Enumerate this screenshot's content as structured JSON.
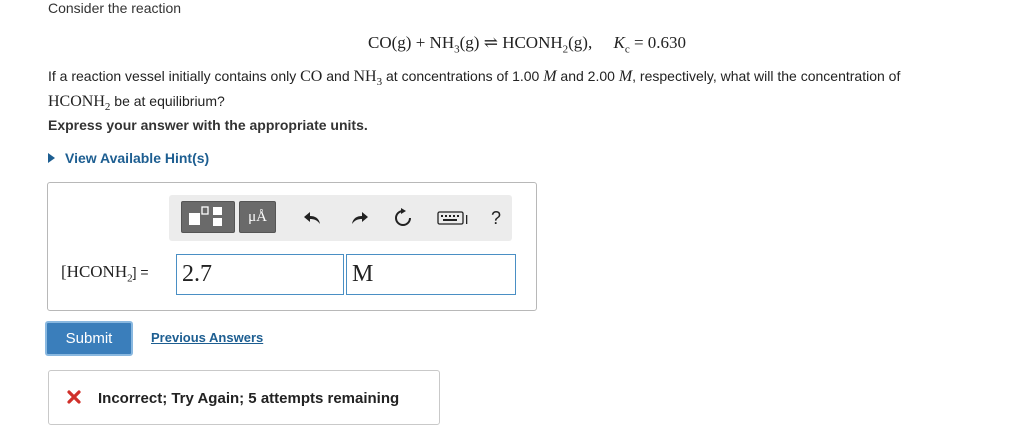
{
  "problem": {
    "intro": "Consider the reaction",
    "equation": {
      "reactant_1": "CO(g)",
      "plus": "+",
      "reactant_2_base": "NH",
      "reactant_2_sub": "3",
      "reactant_2_phase": "(g)",
      "arrow": "⇌",
      "product_base": "HCONH",
      "product_sub": "2",
      "product_phase": "(g),",
      "k_symbol": "K",
      "k_sub": "c",
      "k_value": "= 0.630"
    },
    "question": {
      "part_1": "If a reaction vessel initially contains only ",
      "species_1": "CO",
      "part_2": " and ",
      "species_2_base": "NH",
      "species_2_sub": "3",
      "part_3": " at concentrations of 1.00 ",
      "unit_1": "M",
      "part_4": " and 2.00 ",
      "unit_2": "M",
      "part_5": ", respectively, what will the concentration of ",
      "species_3_base": "HCONH",
      "species_3_sub": "2",
      "part_6": " be at equilibrium?"
    },
    "instruction": "Express your answer with the appropriate units.",
    "hint_link": "View Available Hint(s)"
  },
  "answer": {
    "variable_open": "[HCONH",
    "variable_sub": "2",
    "variable_close": "] =",
    "value": "2.7",
    "unit": "M",
    "toolbar": {
      "units_button": "μÅ",
      "help_symbol": "?"
    }
  },
  "actions": {
    "submit": "Submit",
    "previous_answers": "Previous Answers"
  },
  "feedback": {
    "message": "Incorrect; Try Again; 5 attempts remaining",
    "status_color": "#d0302a"
  },
  "colors": {
    "accent": "#3a7ebb",
    "link": "#1d5e91"
  }
}
